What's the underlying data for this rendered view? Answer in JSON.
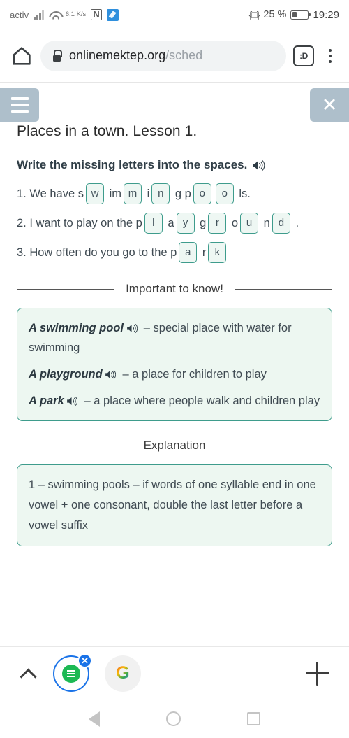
{
  "status_bar": {
    "carrier": "activ",
    "data_rate": "6,1\nK/s",
    "nfc_label": "N",
    "battery_percent": "25 %",
    "clock": "19:29"
  },
  "browser": {
    "url_main": "onlinemektep.org",
    "url_path": "/sched",
    "emoji_button_label": ":D"
  },
  "page": {
    "menu_label": "☰",
    "close_label": "✕",
    "lesson_title": "Places in a town. Lesson 1.",
    "instruction": "Write the missing letters into the spaces.",
    "questions": [
      {
        "number": "1.",
        "parts": [
          {
            "type": "text",
            "value": "1. We have s"
          },
          {
            "type": "blank",
            "value": "w"
          },
          {
            "type": "text",
            "value": " im"
          },
          {
            "type": "blank",
            "value": "m"
          },
          {
            "type": "text",
            "value": " i"
          },
          {
            "type": "blank",
            "value": "n"
          },
          {
            "type": "text",
            "value": " g p"
          },
          {
            "type": "blank",
            "value": "o"
          },
          {
            "type": "blank",
            "value": "o"
          },
          {
            "type": "text",
            "value": " ls."
          }
        ]
      },
      {
        "number": "2.",
        "parts": [
          {
            "type": "text",
            "value": "2. I want to play on the p"
          },
          {
            "type": "blank",
            "value": "l"
          },
          {
            "type": "text",
            "value": " a"
          },
          {
            "type": "blank",
            "value": "y"
          },
          {
            "type": "text",
            "value": " g"
          },
          {
            "type": "blank",
            "value": "r"
          },
          {
            "type": "text",
            "value": " o"
          },
          {
            "type": "blank",
            "value": "u"
          },
          {
            "type": "text",
            "value": " n"
          },
          {
            "type": "blank",
            "value": "d"
          },
          {
            "type": "text",
            "value": " ."
          }
        ]
      },
      {
        "number": "3.",
        "parts": [
          {
            "type": "text",
            "value": "3. How often do you go to the p"
          },
          {
            "type": "blank",
            "value": "a"
          },
          {
            "type": "text",
            "value": " r"
          },
          {
            "type": "blank",
            "value": "k"
          }
        ]
      }
    ],
    "important_divider_label": "Important to know!",
    "vocabulary": [
      {
        "term": "A swimming pool",
        "definition": " – special place with water for swimming"
      },
      {
        "term": "A playground",
        "definition": " – a place for children to play"
      },
      {
        "term": "A park",
        "definition": " – a place where people walk and children play"
      }
    ],
    "explanation_divider_label": "Explanation",
    "explanation": "1 – swimming pools – if words of one syllable end in one vowel + one consonant, double the last letter before a vowel suffix"
  },
  "tabstrip": {
    "collapse_label": "⌃",
    "active_tab_close_label": "✕",
    "google_tab_label": "G",
    "new_tab_label": "+"
  },
  "colors": {
    "accent_teal": "#3e9c8c",
    "box_fill": "#edf7f1",
    "header_button": "#aebfcb",
    "browser_blue": "#1a73e8"
  }
}
